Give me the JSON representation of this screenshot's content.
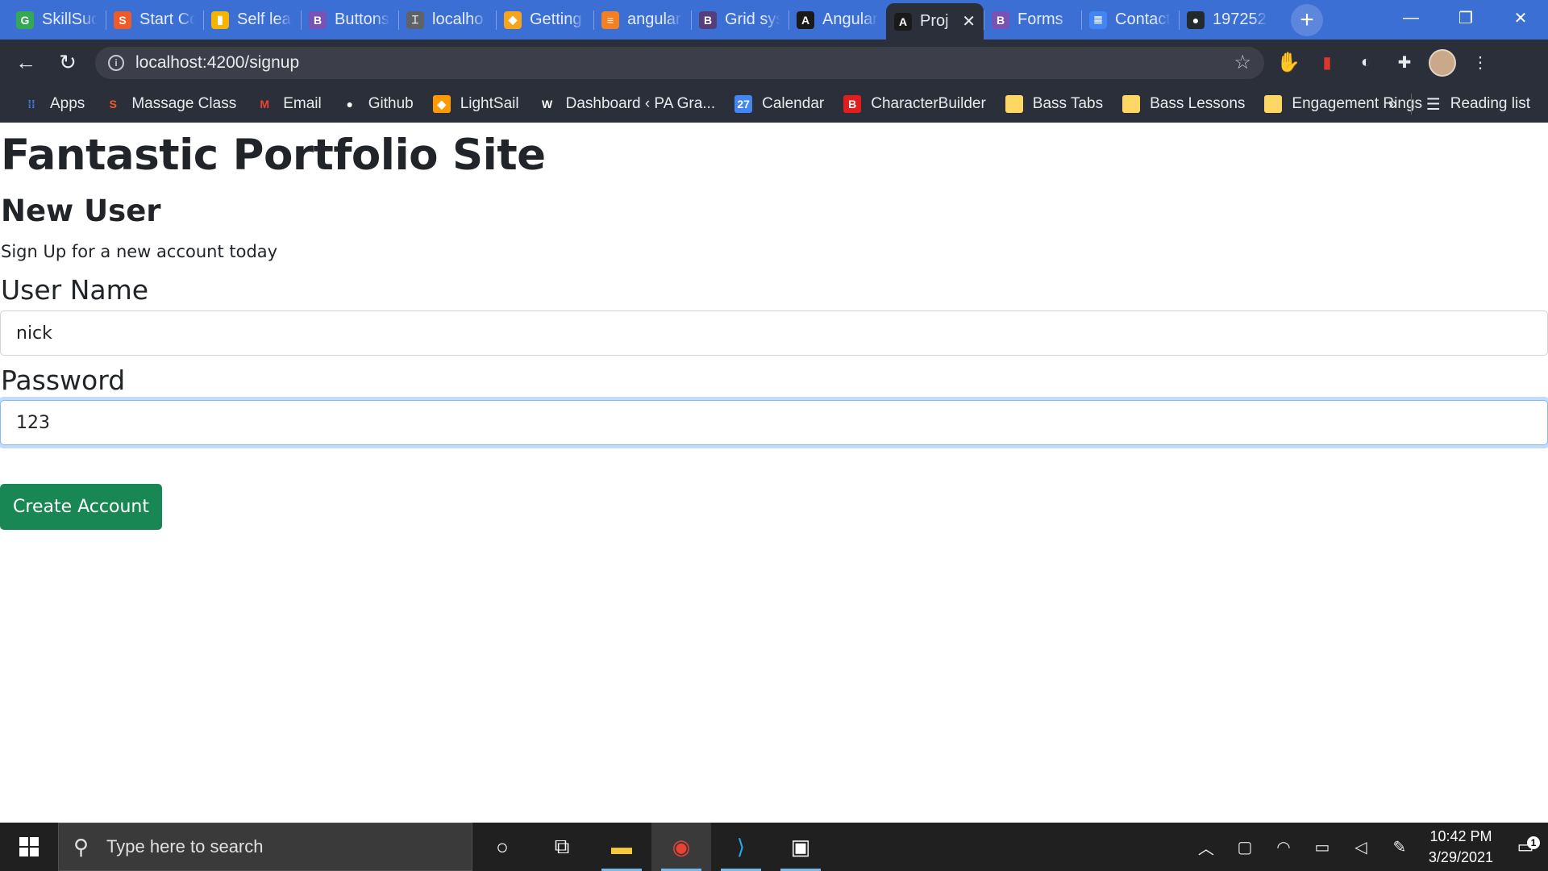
{
  "browser": {
    "tabs": [
      {
        "title": "SkillSuc",
        "icon": "google-icon",
        "color": "#34a853",
        "glyph": "G"
      },
      {
        "title": "Start Co",
        "icon": "stack-icon",
        "color": "#f05a28",
        "glyph": "S"
      },
      {
        "title": "Self lear",
        "icon": "bookmark-icon",
        "color": "#f4b400",
        "glyph": "▮"
      },
      {
        "title": "Buttons",
        "icon": "bootstrap-icon",
        "color": "#7952b3",
        "glyph": "B"
      },
      {
        "title": "localho",
        "icon": "tool-icon",
        "color": "#5f6368",
        "glyph": "⌶"
      },
      {
        "title": "Getting",
        "icon": "shield-icon",
        "color": "#f7a41d",
        "glyph": "◆"
      },
      {
        "title": "angular",
        "icon": "stackoverflow-icon",
        "color": "#f48024",
        "glyph": "≡"
      },
      {
        "title": "Grid sys",
        "icon": "bootstrap-icon",
        "color": "#563d7c",
        "glyph": "B"
      },
      {
        "title": "Angular",
        "icon": "angular-icon",
        "color": "#1a1a1a",
        "glyph": "A"
      },
      {
        "title": "Proj",
        "icon": "angular-icon",
        "color": "#1a1a1a",
        "glyph": "A",
        "active": true
      },
      {
        "title": "Forms",
        "icon": "bootstrap-icon",
        "color": "#7952b3",
        "glyph": "B"
      },
      {
        "title": "Contact",
        "icon": "docs-icon",
        "color": "#4285f4",
        "glyph": "≣"
      },
      {
        "title": "197252",
        "icon": "github-icon",
        "color": "#24292e",
        "glyph": "●"
      }
    ],
    "new_tab_label": "+",
    "url": "localhost:4200/signup",
    "bookmarks": [
      {
        "label": "Apps",
        "icon": "apps-icon",
        "color": "#4285f4",
        "glyph": "⁞⁞"
      },
      {
        "label": "Massage Class",
        "icon": "stack-icon",
        "color": "#f05a28",
        "glyph": "S"
      },
      {
        "label": "Email",
        "icon": "gmail-icon",
        "color": "#ea4335",
        "glyph": "M"
      },
      {
        "label": "Github",
        "icon": "github-icon",
        "color": "#ffffff",
        "glyph": "●"
      },
      {
        "label": "LightSail",
        "icon": "lightsail-icon",
        "color": "#f90",
        "glyph": "◆"
      },
      {
        "label": "Dashboard ‹ PA Gra...",
        "icon": "wordpress-icon",
        "color": "#ffffff",
        "glyph": "W"
      },
      {
        "label": "Calendar",
        "icon": "calendar-icon",
        "color": "#4285f4",
        "glyph": "27"
      },
      {
        "label": "CharacterBuilder",
        "icon": "characterbuilder-icon",
        "color": "#e21d1d",
        "glyph": "B"
      },
      {
        "label": "Bass Tabs",
        "icon": "folder-icon",
        "color": "#fdd663",
        "glyph": ""
      },
      {
        "label": "Bass Lessons",
        "icon": "folder-icon",
        "color": "#fdd663",
        "glyph": ""
      },
      {
        "label": "Engagement Rings",
        "icon": "folder-icon",
        "color": "#fdd663",
        "glyph": ""
      }
    ],
    "more_bookmarks": "»",
    "reading_list": "Reading list"
  },
  "page": {
    "site_title": "Fantastic Portfolio Site",
    "form_title": "New User",
    "form_subtitle": "Sign Up for a new account today",
    "username_label": "User Name",
    "username_value": "nick",
    "password_label": "Password",
    "password_value": "123",
    "submit_label": "Create Account",
    "accent_color": "#198754"
  },
  "taskbar": {
    "search_placeholder": "Type here to search",
    "time": "10:42 PM",
    "date": "3/29/2021",
    "notification_count": "1"
  }
}
